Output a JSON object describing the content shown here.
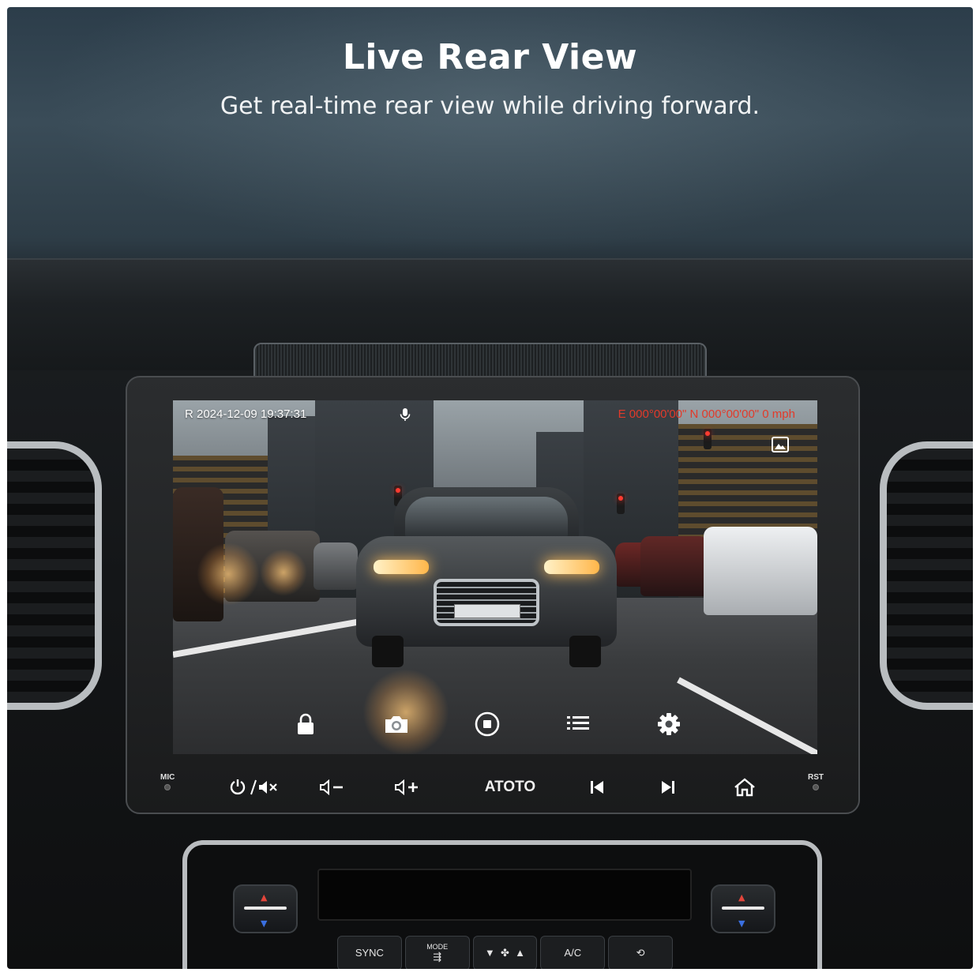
{
  "headline": {
    "title": "Live Rear View",
    "subtitle": "Get real-time rear view while driving forward."
  },
  "camera_view": {
    "timestamp": "R 2024-12-09  19:37:31",
    "gps_readout": "E 000°00'00\" N 000°00'00\"   0 mph",
    "mic_icon": "microphone-icon",
    "gallery_icon": "gallery-icon",
    "controls": [
      {
        "name": "lock",
        "icon": "lock-icon"
      },
      {
        "name": "snapshot",
        "icon": "camera-icon"
      },
      {
        "name": "record",
        "icon": "record-stop-icon"
      },
      {
        "name": "list",
        "icon": "list-icon"
      },
      {
        "name": "settings",
        "icon": "gear-icon"
      }
    ]
  },
  "head_unit": {
    "mic_label": "MIC",
    "rst_label": "RST",
    "power_mute_label": "⏻/🔇",
    "brand": "ATOTO",
    "buttons": [
      {
        "name": "power-mute",
        "icon": "power-mute-icon"
      },
      {
        "name": "volume-down",
        "icon": "volume-down-icon"
      },
      {
        "name": "volume-up",
        "icon": "volume-up-icon"
      },
      {
        "name": "previous",
        "icon": "skip-previous-icon"
      },
      {
        "name": "next",
        "icon": "skip-next-icon"
      },
      {
        "name": "home",
        "icon": "home-icon"
      }
    ]
  },
  "climate": {
    "sync": "SYNC",
    "mode": "MODE",
    "ac": "A/C"
  },
  "colors": {
    "gps_text": "#e23a2a",
    "osd_text": "#ffffff",
    "bezel": "#1a1b1c"
  }
}
